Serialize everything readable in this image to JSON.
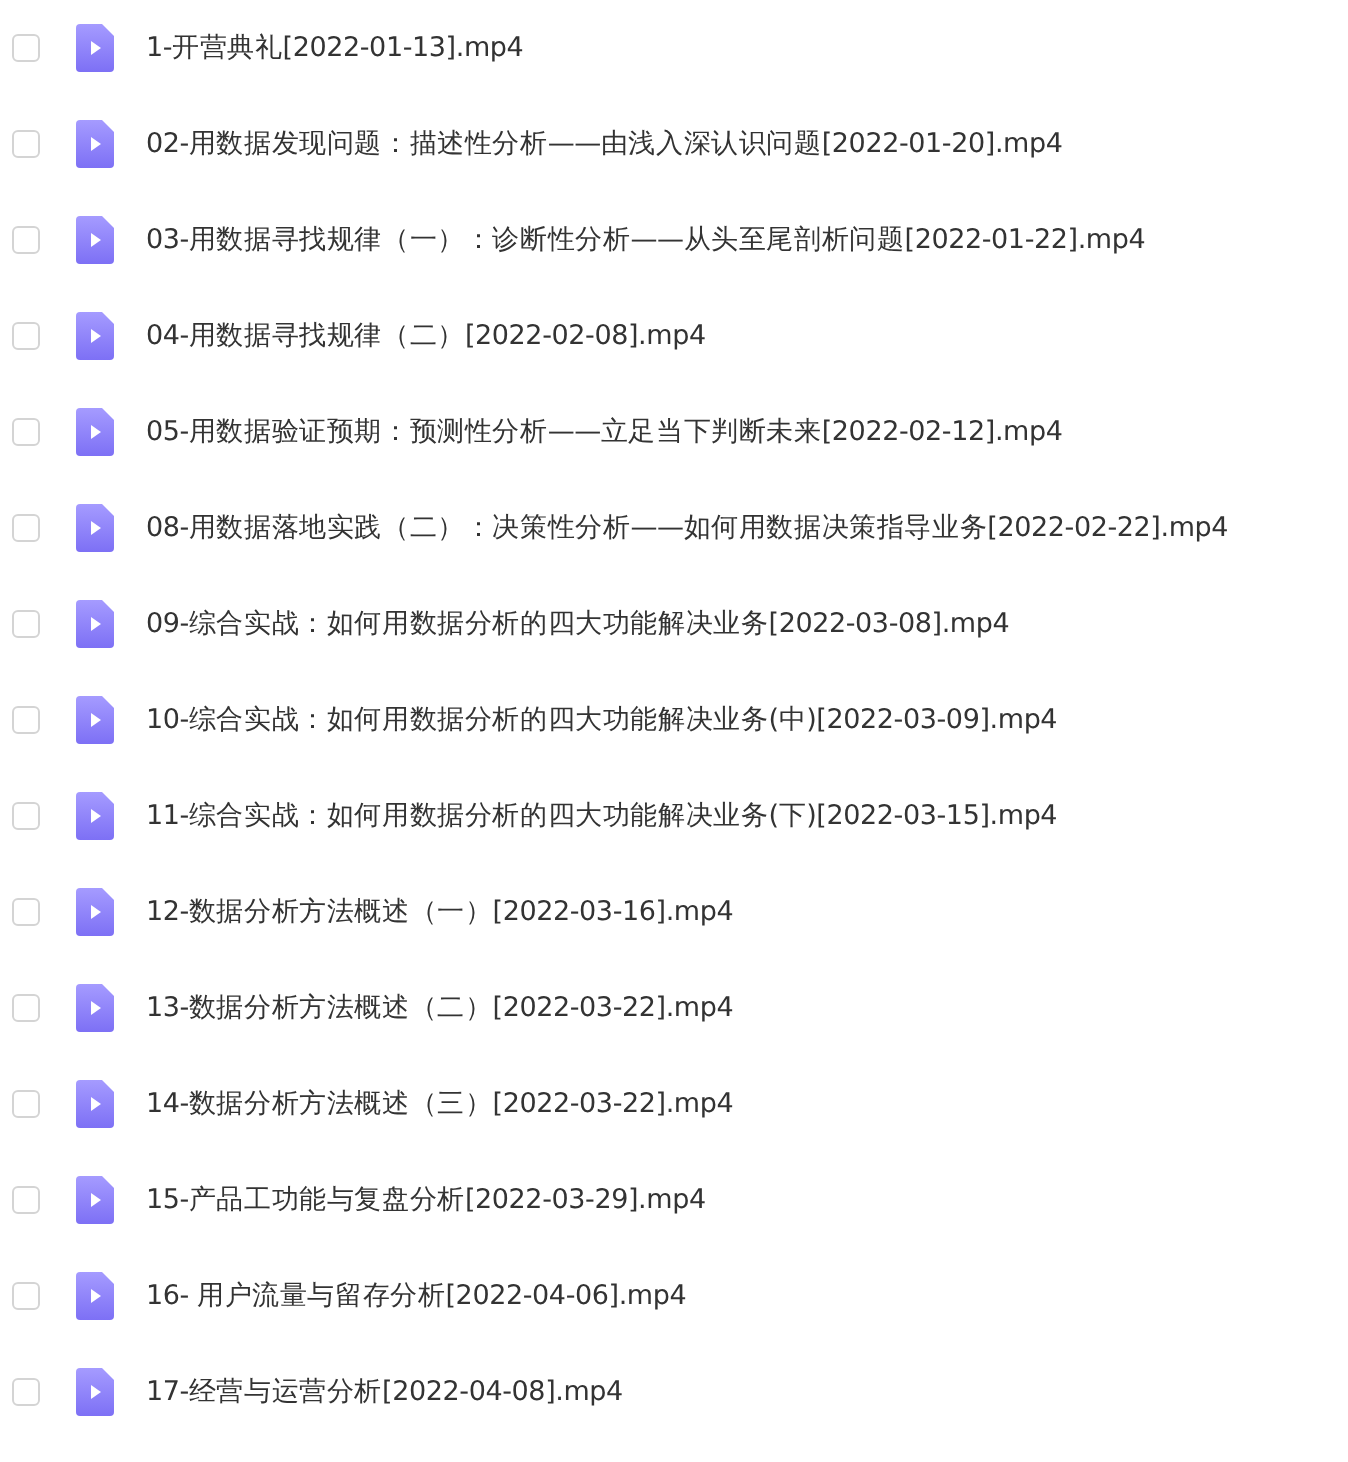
{
  "files": [
    {
      "name": "1-开营典礼[2022-01-13].mp4",
      "checked": false
    },
    {
      "name": "02-用数据发现问题：描述性分析——由浅入深认识问题[2022-01-20].mp4",
      "checked": false
    },
    {
      "name": "03-用数据寻找规律（一）：诊断性分析——从头至尾剖析问题[2022-01-22].mp4",
      "checked": false
    },
    {
      "name": "04-用数据寻找规律（二）[2022-02-08].mp4",
      "checked": false
    },
    {
      "name": "05-用数据验证预期：预测性分析——立足当下判断未来[2022-02-12].mp4",
      "checked": false
    },
    {
      "name": "08-用数据落地实践（二）：决策性分析——如何用数据决策指导业务[2022-02-22].mp4",
      "checked": false
    },
    {
      "name": "09-综合实战：如何用数据分析的四大功能解决业务[2022-03-08].mp4",
      "checked": false
    },
    {
      "name": "10-综合实战：如何用数据分析的四大功能解决业务(中)[2022-03-09].mp4",
      "checked": false
    },
    {
      "name": "11-综合实战：如何用数据分析的四大功能解决业务(下)[2022-03-15].mp4",
      "checked": false
    },
    {
      "name": "12-数据分析方法概述（一）[2022-03-16].mp4",
      "checked": false
    },
    {
      "name": "13-数据分析方法概述（二）[2022-03-22].mp4",
      "checked": false
    },
    {
      "name": "14-数据分析方法概述（三）[2022-03-22].mp4",
      "checked": false
    },
    {
      "name": "15-产品工功能与复盘分析[2022-03-29].mp4",
      "checked": false
    },
    {
      "name": "16- 用户流量与留存分析[2022-04-06].mp4",
      "checked": false
    },
    {
      "name": "17-经营与运营分析[2022-04-08].mp4",
      "checked": false
    }
  ]
}
